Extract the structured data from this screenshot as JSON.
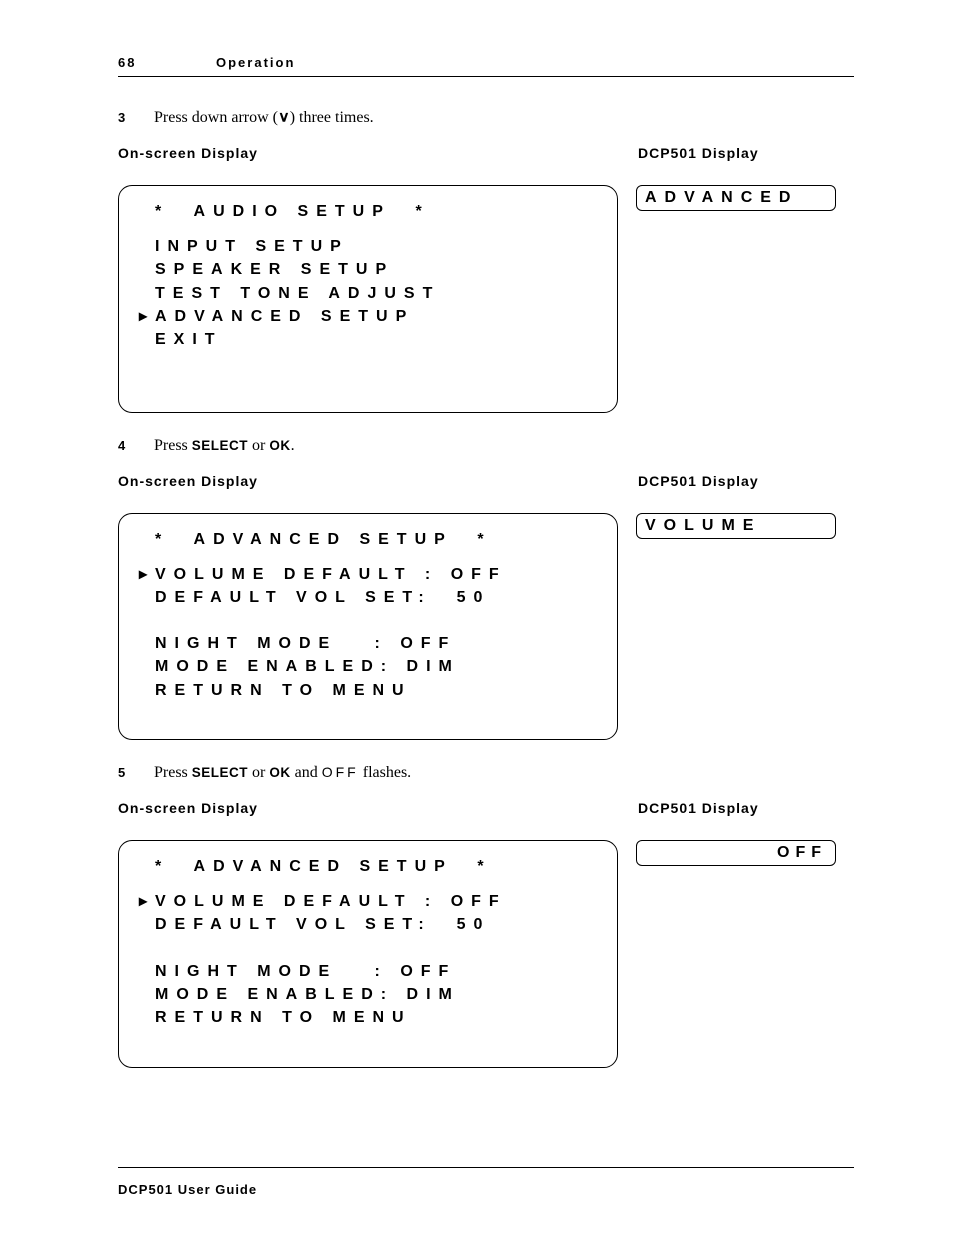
{
  "header": {
    "page_number": "68",
    "section": "Operation"
  },
  "footer": {
    "text": "DCP501 User Guide"
  },
  "labels": {
    "osd": "On-screen Display",
    "dcp": "DCP501 Display"
  },
  "steps": [
    {
      "num": "3",
      "pre": "Press down arrow (",
      "arrow": "∨",
      "post": ") three times.",
      "osd_title": "*  AUDIO SETUP  *",
      "osd_lines": [
        {
          "arrow": "",
          "text": "INPUT SETUP"
        },
        {
          "arrow": "",
          "text": "SPEAKER SETUP"
        },
        {
          "arrow": "",
          "text": "TEST TONE ADJUST"
        },
        {
          "arrow": "▸",
          "text": "ADVANCED SETUP"
        },
        {
          "arrow": "",
          "text": "EXIT"
        },
        {
          "arrow": "",
          "text": " "
        },
        {
          "arrow": "",
          "text": " "
        }
      ],
      "dcp": "ADVANCED",
      "dcp_align": "left"
    },
    {
      "num": "4",
      "pre": "Press ",
      "bold1": "SELECT",
      "mid": " or ",
      "bold2": "OK",
      "post": ".",
      "osd_title": "*  ADVANCED SETUP  *",
      "osd_lines": [
        {
          "arrow": "▸",
          "text": "VOLUME DEFAULT : OFF"
        },
        {
          "arrow": "",
          "text": "DEFAULT VOL SET:  50"
        },
        {
          "arrow": "",
          "text": " "
        },
        {
          "arrow": "",
          "text": "NIGHT MODE   : OFF"
        },
        {
          "arrow": "",
          "text": "MODE ENABLED: DIM"
        },
        {
          "arrow": "",
          "text": "RETURN TO MENU"
        },
        {
          "arrow": "",
          "text": " "
        }
      ],
      "dcp": "VOLUME",
      "dcp_align": "left"
    },
    {
      "num": "5",
      "pre": "Press ",
      "bold1": "SELECT",
      "mid": " or ",
      "bold2": "OK",
      "post2_pre": " and ",
      "mono": "OFF",
      "post2_post": " flashes.",
      "osd_title": "*  ADVANCED SETUP  *",
      "osd_lines": [
        {
          "arrow": "▸",
          "text": "VOLUME DEFAULT : OFF"
        },
        {
          "arrow": "",
          "text": "DEFAULT VOL SET:  50"
        },
        {
          "arrow": "",
          "text": " "
        },
        {
          "arrow": "",
          "text": "NIGHT MODE   : OFF"
        },
        {
          "arrow": "",
          "text": "MODE ENABLED: DIM"
        },
        {
          "arrow": "",
          "text": "RETURN TO MENU"
        },
        {
          "arrow": "",
          "text": " "
        }
      ],
      "dcp": "OFF",
      "dcp_align": "right"
    }
  ]
}
